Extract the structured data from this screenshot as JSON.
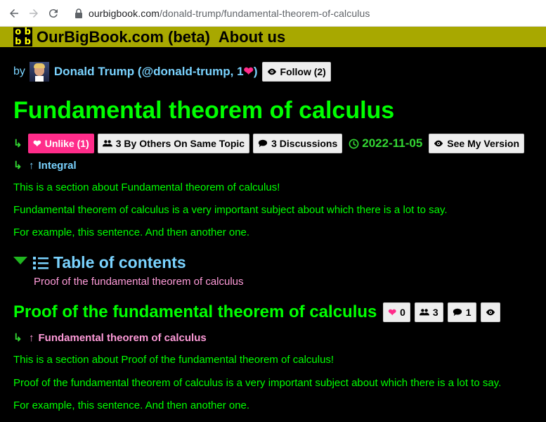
{
  "browser": {
    "url_host": "ourbigbook.com",
    "url_path": "/donald-trump/fundamental-theorem-of-calculus"
  },
  "header": {
    "site_title": "OurBigBook.com (beta)",
    "about": "About us",
    "bg_color": "#a8a800"
  },
  "author": {
    "by": "by",
    "name": "Donald Trump (@donald-trump, 1",
    "close": ")",
    "follow_label": "Follow (2)"
  },
  "page": {
    "title": "Fundamental theorem of calculus",
    "unlike_label": "Unlike (1)",
    "others_label": "3 By Others On Same Topic",
    "discussions_label": "3 Discussions",
    "date": "2022-11-05",
    "see_version_label": "See My Version",
    "parent_label": "Integral",
    "paragraphs": [
      "This is a section about Fundamental theorem of calculus!",
      "Fundamental theorem of calculus is a very important subject about which there is a lot to say.",
      "For example, this sentence. And then another one."
    ]
  },
  "toc": {
    "title": "Table of contents",
    "items": [
      "Proof of the fundamental theorem of calculus"
    ]
  },
  "subsection": {
    "title": "Proof of the fundamental theorem of calculus",
    "likes": "0",
    "others": "3",
    "discussions": "1",
    "parent_label": "Fundamental theorem of calculus",
    "paragraphs": [
      "This is a section about Proof of the fundamental theorem of calculus!",
      "Proof of the fundamental theorem of calculus is a very important subject about which there is a lot to say.",
      "For example, this sentence. And then another one."
    ]
  },
  "colors": {
    "green_text": "#00ff00",
    "link_blue": "#7ad3ff",
    "pink": "#ff2c8a",
    "toc_pink": "#ff9bd9"
  }
}
